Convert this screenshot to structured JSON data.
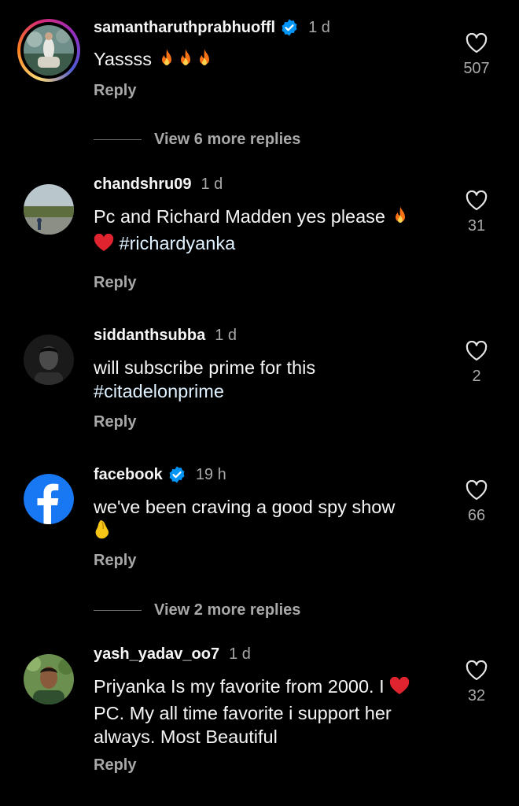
{
  "comments": [
    {
      "username": "samantharuthprabhuoffl",
      "verified": true,
      "time": "1 d",
      "text": "Yassss",
      "emoji": [
        "fire-icon",
        "fire-icon",
        "fire-icon"
      ],
      "reply": "Reply",
      "likes": "507",
      "view_more": "View 6 more replies"
    },
    {
      "username": "chandshru09",
      "verified": false,
      "time": "1 d",
      "text_line1": "Pc and Richard Madden yes please",
      "emoji_line1": "fire-icon",
      "emoji_line2": "red-heart-icon",
      "hashtag": "#richardyanka",
      "reply": "Reply",
      "likes": "31"
    },
    {
      "username": "siddanthsubba",
      "verified": false,
      "time": "1 d",
      "text_line1": "will subscribe prime for this",
      "hashtag": "#citadelonprime",
      "reply": "Reply",
      "likes": "2"
    },
    {
      "username": "facebook",
      "verified": true,
      "time": "19 h",
      "text_line1": "we've been craving a good spy show",
      "emoji_line2": "pinched-fingers-icon",
      "reply": "Reply",
      "likes": "66",
      "view_more": "View 2 more replies"
    },
    {
      "username": "yash_yadav_oo7",
      "verified": false,
      "time": "1 d",
      "text_line1": "Priyanka Is my favorite from 2000. I",
      "emoji_line1": "red-heart-icon",
      "text_line2": "PC. My all time favorite i support her",
      "text_line3": "always. Most Beautiful",
      "reply": "Reply",
      "likes": "32"
    }
  ],
  "colors": {
    "background": "#000000",
    "text": "#f5f5f5",
    "muted": "#a8a8a8",
    "verified": "#0095f6",
    "hashtag": "#e0f1ff"
  }
}
